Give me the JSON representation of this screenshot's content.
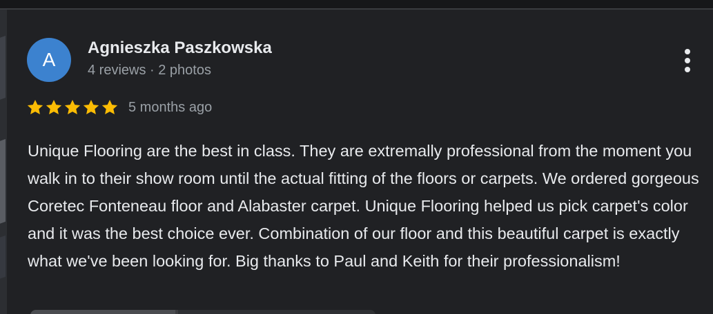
{
  "review": {
    "avatar_initial": "A",
    "reviewer_name": "Agnieszka Paszkowska",
    "reviewer_meta": "4 reviews · 2 photos",
    "rating": 5,
    "rating_max": 5,
    "date": "5 months ago",
    "text": "Unique Flooring are the best in class. They are extremally professional from the moment you walk in to their show room until the actual fitting of the floors or carpets. We ordered gorgeous Coretec Fonteneau floor and Alabaster carpet. Unique Flooring helped us pick carpet's color and it was the best choice ever. Combination of our floor and this beautiful carpet is exactly what we've been looking for. Big thanks to Paul and Keith for their professionalism!",
    "more_icon": "more-vert-icon",
    "star_icon": "star-icon"
  },
  "colors": {
    "card_background": "#202124",
    "avatar_background": "#3c82cf",
    "star": "#fbbc04",
    "primary_text": "#e8eaed",
    "secondary_text": "#9aa0a6"
  }
}
